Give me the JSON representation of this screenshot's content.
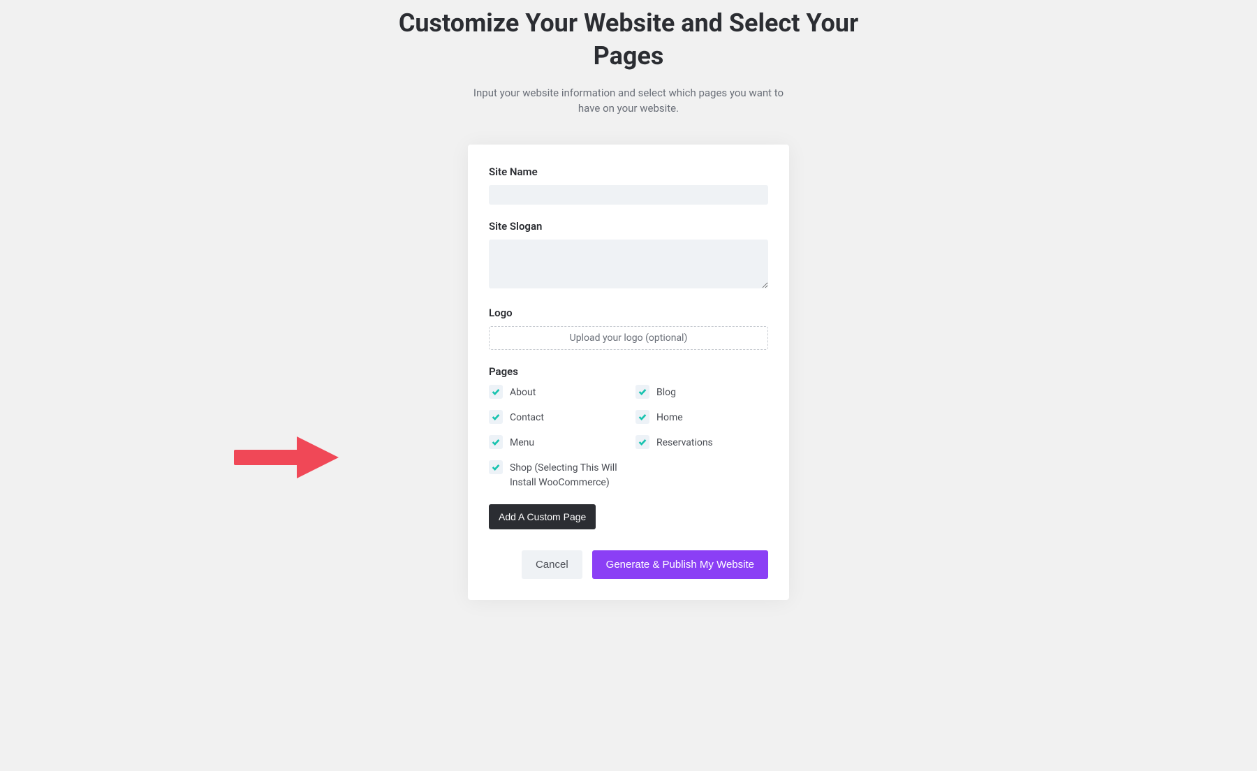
{
  "header": {
    "title": "Customize Your Website and Select Your Pages",
    "subtitle": "Input your website information and select which pages you want to have on your website."
  },
  "form": {
    "site_name": {
      "label": "Site Name",
      "value": ""
    },
    "site_slogan": {
      "label": "Site Slogan",
      "value": ""
    },
    "logo": {
      "label": "Logo",
      "upload_text": "Upload your logo (optional)"
    },
    "pages": {
      "label": "Pages",
      "items": [
        {
          "label": "About",
          "checked": true
        },
        {
          "label": "Blog",
          "checked": true
        },
        {
          "label": "Contact",
          "checked": true
        },
        {
          "label": "Home",
          "checked": true
        },
        {
          "label": "Menu",
          "checked": true
        },
        {
          "label": "Reservations",
          "checked": true
        },
        {
          "label": "Shop (Selecting This Will Install WooCommerce)",
          "checked": true
        }
      ]
    },
    "add_custom_label": "Add A Custom Page"
  },
  "actions": {
    "cancel_label": "Cancel",
    "primary_label": "Generate & Publish My Website"
  },
  "colors": {
    "accent": "#8b3ff5",
    "checkbox_check": "#18c3af",
    "arrow": "#f04857"
  }
}
